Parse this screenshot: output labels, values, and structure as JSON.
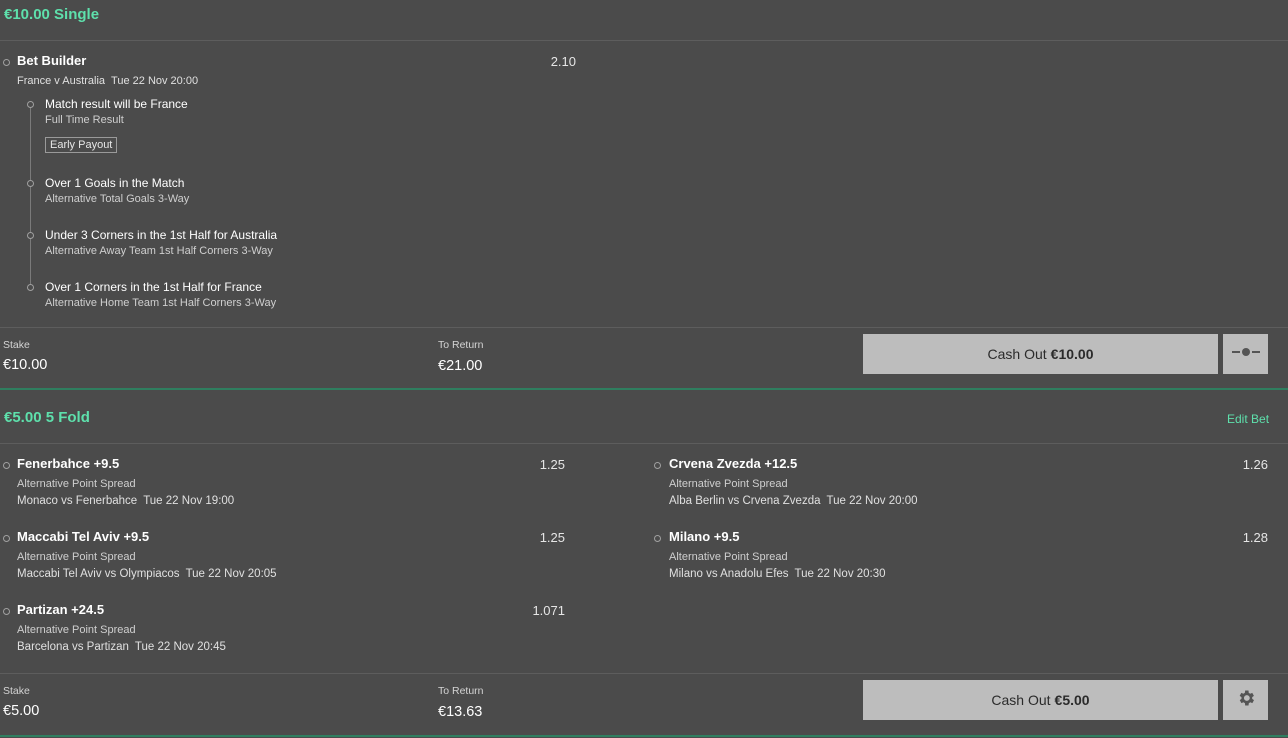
{
  "bets": [
    {
      "title": "€10.00 Single",
      "builder": {
        "name": "Bet Builder",
        "odds": "2.10",
        "event": "France v Australia",
        "date": "Tue 22 Nov 20:00",
        "legs": [
          {
            "name": "Match result will be France",
            "market": "Full Time Result",
            "badge": "Early Payout"
          },
          {
            "name": "Over 1 Goals in the Match",
            "market": "Alternative Total Goals 3-Way"
          },
          {
            "name": "Under 3 Corners in the 1st Half for Australia",
            "market": "Alternative Away Team 1st Half Corners 3-Way"
          },
          {
            "name": "Over 1 Corners in the 1st Half for France",
            "market": "Alternative Home Team 1st Half Corners 3-Way"
          }
        ]
      },
      "stake_label": "Stake",
      "stake": "€10.00",
      "return_label": "To Return",
      "return": "€21.00",
      "cashout_label": "Cash Out",
      "cashout_amount": "€10.00",
      "side_icon": "slider-toggle-icon"
    },
    {
      "title": "€5.00 5 Fold",
      "edit_label": "Edit Bet",
      "selections": [
        {
          "name": "Fenerbahce +9.5",
          "odds": "1.25",
          "market": "Alternative Point Spread",
          "event": "Monaco vs Fenerbahce",
          "date": "Tue 22 Nov 19:00"
        },
        {
          "name": "Crvena Zvezda +12.5",
          "odds": "1.26",
          "market": "Alternative Point Spread",
          "event": "Alba Berlin vs Crvena Zvezda",
          "date": "Tue 22 Nov 20:00"
        },
        {
          "name": "Maccabi Tel Aviv +9.5",
          "odds": "1.25",
          "market": "Alternative Point Spread",
          "event": "Maccabi Tel Aviv vs Olympiacos",
          "date": "Tue 22 Nov 20:05"
        },
        {
          "name": "Milano +9.5",
          "odds": "1.28",
          "market": "Alternative Point Spread",
          "event": "Milano vs Anadolu Efes",
          "date": "Tue 22 Nov 20:30"
        },
        {
          "name": "Partizan +24.5",
          "odds": "1.071",
          "market": "Alternative Point Spread",
          "event": "Barcelona vs Partizan",
          "date": "Tue 22 Nov 20:45"
        }
      ],
      "stake_label": "Stake",
      "stake": "€5.00",
      "return_label": "To Return",
      "return": "€13.63",
      "cashout_label": "Cash Out",
      "cashout_amount": "€5.00",
      "side_icon": "gear-icon"
    }
  ]
}
